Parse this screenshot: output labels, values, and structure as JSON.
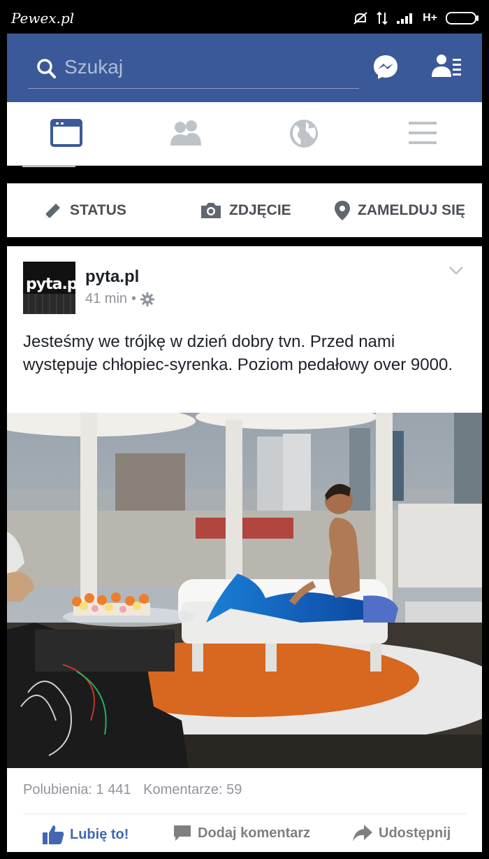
{
  "statusbar": {
    "watermark": "Pewex.pl",
    "network": "H+"
  },
  "header": {
    "search_placeholder": "Szukaj"
  },
  "icons": {
    "search": "search-icon",
    "messenger": "messenger-icon",
    "friends": "friend-requests-icon"
  },
  "tabs": [
    "news-feed-icon",
    "friends-icon",
    "notifications-globe-icon",
    "menu-icon"
  ],
  "composer": {
    "status": "STATUS",
    "photo": "ZDJĘCIE",
    "checkin": "ZAMELDUJ SIĘ"
  },
  "post": {
    "avatar_text": "pyta.pl",
    "page_name": "pyta.pl",
    "time": "41 min",
    "dot": "•",
    "text": "Jesteśmy we trójkę w dzień dobry tvn. Przed nami występuje chłopiec-syrenka. Poziom pedałowy over 9000.",
    "likes": "Polubienia: 1 441",
    "comments": "Komentarze: 59"
  },
  "actions": {
    "like": "Lubię to!",
    "comment": "Dodaj komentarz",
    "share": "Udostępnij"
  },
  "colors": {
    "brand": "#3b5998",
    "accent": "#4267b2"
  }
}
